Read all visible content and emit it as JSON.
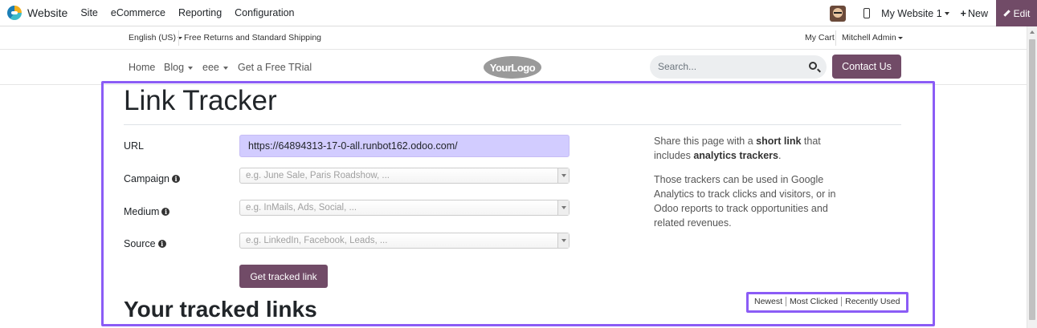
{
  "adminbar": {
    "brand": "Website",
    "menu": [
      "Site",
      "eCommerce",
      "Reporting",
      "Configuration"
    ],
    "site_selector": "My Website 1",
    "new_label": "New",
    "edit_label": "Edit"
  },
  "subbar": {
    "language": "English (US)",
    "shipping": "Free Returns and Standard Shipping",
    "cart": "My Cart",
    "account": "Mitchell Admin"
  },
  "navbar": {
    "home": "Home",
    "blog": "Blog",
    "eee": "eee",
    "trial": "Get a Free TRial",
    "logo": "YourLogo",
    "search_placeholder": "Search...",
    "contact": "Contact Us"
  },
  "main": {
    "title": "Link Tracker",
    "fields": {
      "url_label": "URL",
      "url_value": "https://64894313-17-0-all.runbot162.odoo.com/",
      "campaign_label": "Campaign",
      "campaign_placeholder": "e.g. June Sale, Paris Roadshow, ...",
      "medium_label": "Medium",
      "medium_placeholder": "e.g. InMails, Ads, Social, ...",
      "source_label": "Source",
      "source_placeholder": "e.g. LinkedIn, Facebook, Leads, ..."
    },
    "button": "Get tracked link",
    "side": {
      "p1_a": "Share this page with a ",
      "p1_b": "short link",
      "p1_c": " that includes ",
      "p1_d": "analytics trackers",
      "p1_e": ".",
      "p2": "Those trackers can be used in Google Analytics to track clicks and visitors, or in Odoo reports to track opportunities and related revenues."
    },
    "links_title": "Your tracked links",
    "filters": [
      "Newest",
      "Most Clicked",
      "Recently Used"
    ]
  },
  "colors": {
    "brand": "#714b67",
    "highlight": "#8b5cf6",
    "url_bg": "#d2ccff"
  }
}
